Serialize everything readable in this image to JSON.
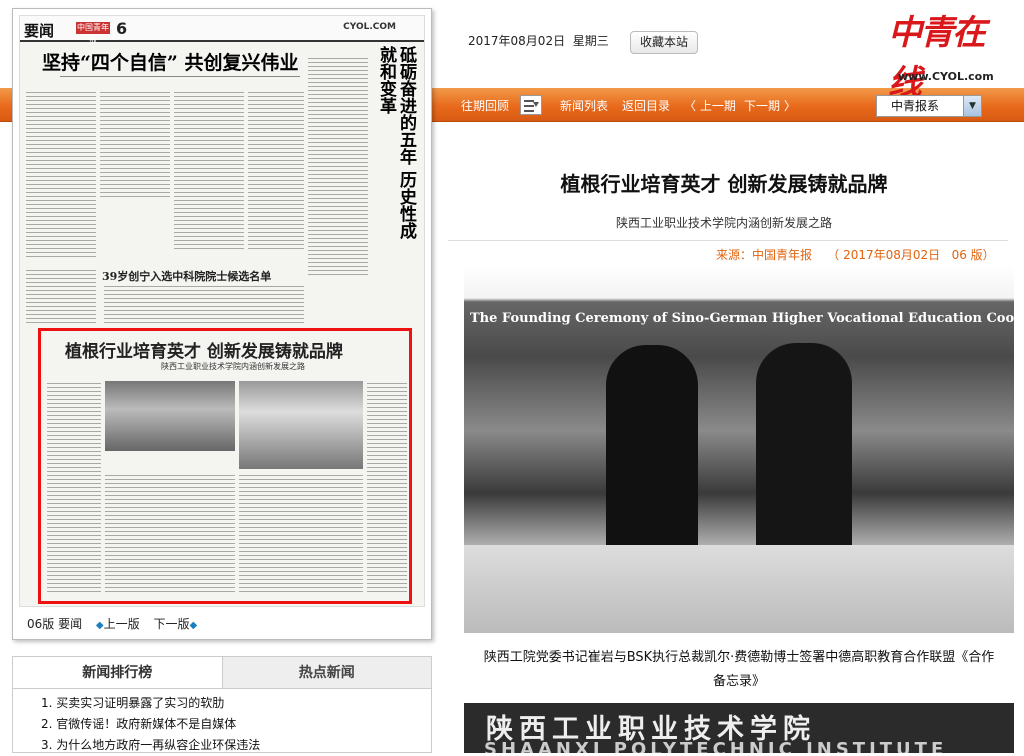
{
  "header": {
    "date": "2017年08月02日",
    "weekday": "星期三",
    "favorite_label": "收藏本站",
    "brand_logo": "中青在线",
    "brand_url": "www.CYOL.com"
  },
  "nav": {
    "past_issues": "往期回顾",
    "news_list": "新闻列表",
    "back_to_index": "返回目录",
    "prev_page": "〈 上一期",
    "next_page": "下一期 〉",
    "paper_select": "中青报系"
  },
  "newspaper": {
    "section": "要闻",
    "page_no": "6",
    "site": "CYOL.COM",
    "headline": "坚持“四个自信” 共创复兴伟业",
    "vertical_headline": "砥砺奋进的五年 历史性成就和变革",
    "small_headline": "39岁创宁入选中科院院士候选名单",
    "boxed_headline": "植根行业培育英才 创新发展铸就品牌",
    "boxed_sub": "陕西工业职业技术学院内涵创新发展之路",
    "footer_page": "06版 要闻",
    "footer_prev": "上一版",
    "footer_next": "下一版"
  },
  "ranking": {
    "tab_active": "新闻排行榜",
    "tab_inactive": "热点新闻",
    "items": [
      "1. 买卖实习证明暴露了实习的软肋",
      "2. 官微传谣！政府新媒体不是自媒体",
      "3. 为什么地方政府一再纵容企业环保违法"
    ]
  },
  "article": {
    "title": "植根行业培育英才 创新发展铸就品牌",
    "subtitle": "陕西工业职业技术学院内涵创新发展之路",
    "meta": "来源：中国青年报    （ 2017年08月02日   06 版）",
    "photo1_banner": "The Founding Ceremony of Sino-German Higher Vocational Education Cooperation Federation",
    "caption": "陕西工院党委书记崔岩与BSK执行总裁凯尔·费德勒博士签署中德高职教育合作联盟《合作备忘录》",
    "photo2_text": "陕西工业职业技术学院",
    "photo2_text2": "SHAANXI POLYTECHNIC INSTITUTE"
  }
}
